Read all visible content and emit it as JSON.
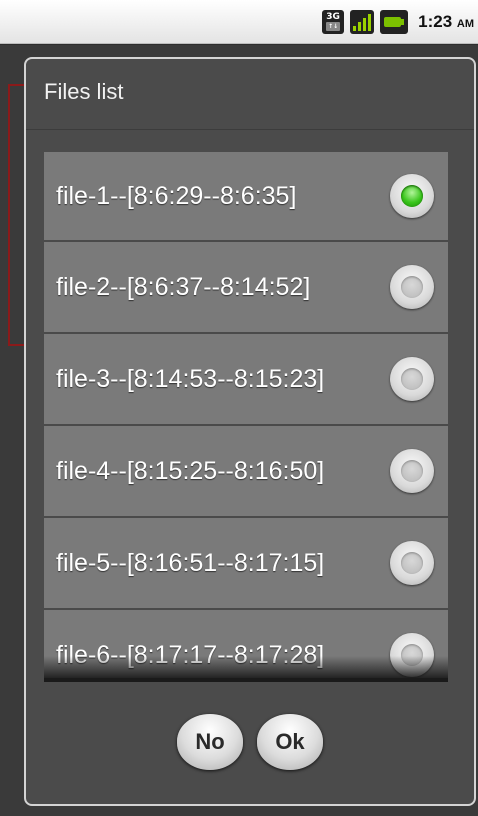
{
  "status_bar": {
    "network_label": "3G",
    "time": "1:23",
    "ampm": "AM"
  },
  "dialog": {
    "title": "Files list",
    "items": [
      {
        "label": "file-1--[8:6:29--8:6:35]",
        "checked": true
      },
      {
        "label": "file-2--[8:6:37--8:14:52]",
        "checked": false
      },
      {
        "label": "file-3--[8:14:53--8:15:23]",
        "checked": false
      },
      {
        "label": "file-4--[8:15:25--8:16:50]",
        "checked": false
      },
      {
        "label": "file-5--[8:16:51--8:17:15]",
        "checked": false
      },
      {
        "label": "file-6--[8:17:17--8:17:28]",
        "checked": false
      }
    ],
    "buttons": {
      "no_label": "No",
      "ok_label": "Ok"
    }
  },
  "colors": {
    "radio_checked": "#39c51b",
    "list_row": "#7a7a7a",
    "dialog_bg": "#4b4b4b"
  }
}
